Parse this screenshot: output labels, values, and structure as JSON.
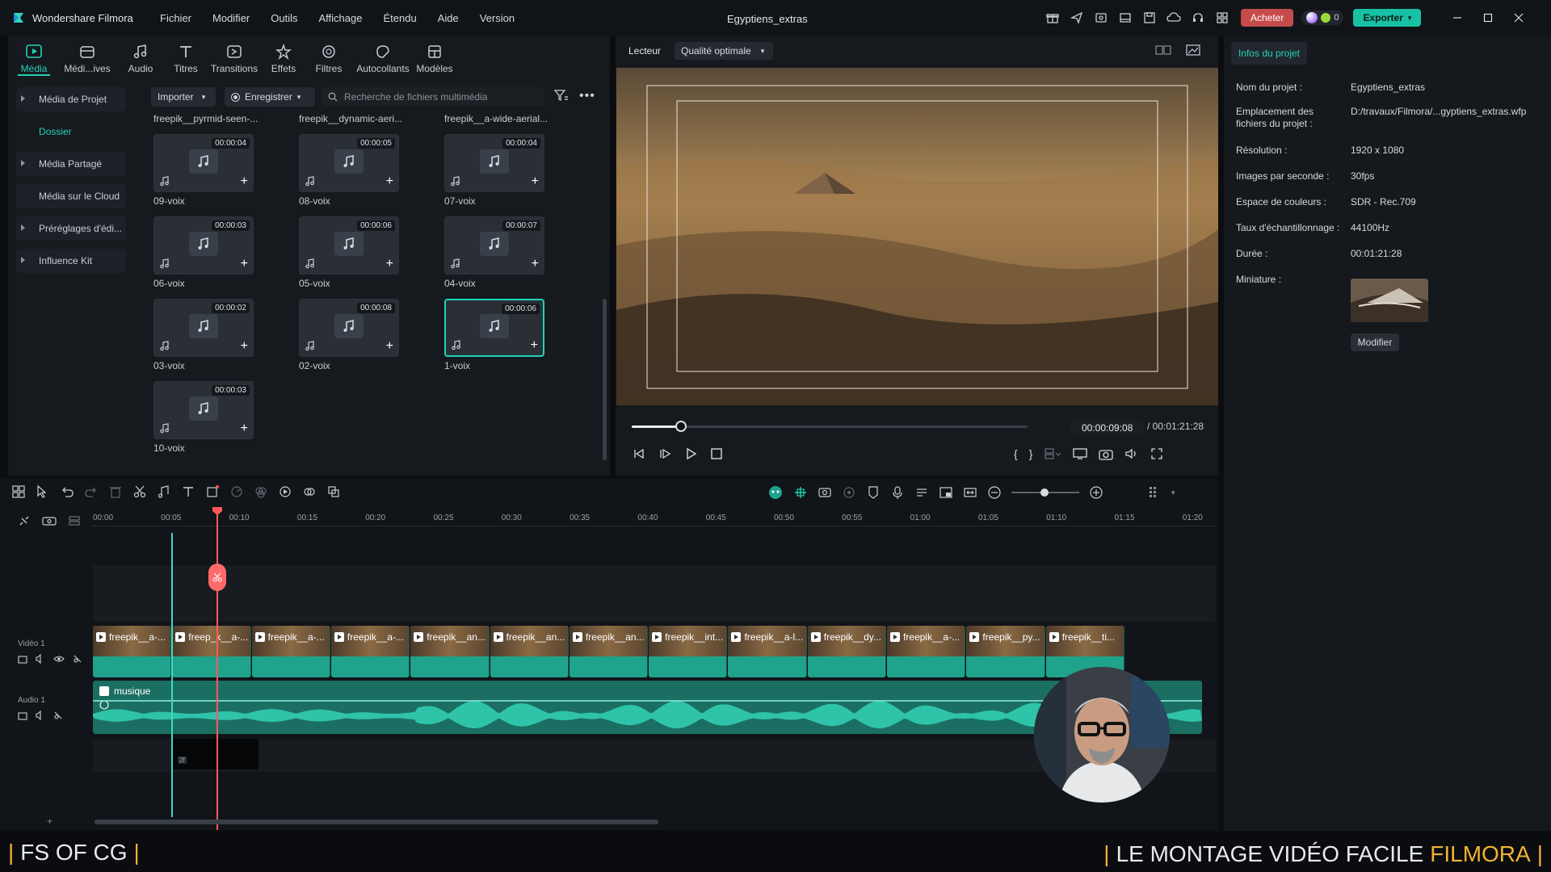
{
  "app": {
    "name": "Wondershare Filmora",
    "project_title": "Egyptiens_extras"
  },
  "menu": [
    "Fichier",
    "Modifier",
    "Outils",
    "Affichage",
    "Étendu",
    "Aide",
    "Version"
  ],
  "topbar": {
    "buy_label": "Acheter",
    "credits": "0",
    "export_label": "Exporter"
  },
  "tool_tabs": [
    {
      "label": "Média",
      "icon": "media-icon"
    },
    {
      "label": "Médi...ives",
      "icon": "stock-media-icon"
    },
    {
      "label": "Audio",
      "icon": "music-icon"
    },
    {
      "label": "Titres",
      "icon": "text-icon"
    },
    {
      "label": "Transitions",
      "icon": "transition-icon"
    },
    {
      "label": "Effets",
      "icon": "effects-icon"
    },
    {
      "label": "Filtres",
      "icon": "filter-icon"
    },
    {
      "label": "Autocollants",
      "icon": "sticker-icon"
    },
    {
      "label": "Modèles",
      "icon": "template-icon"
    }
  ],
  "sidebar": {
    "items": [
      {
        "label": "Média de Projet",
        "expandable": true
      },
      {
        "label": "Dossier",
        "expandable": false
      },
      {
        "label": "Média Partagé",
        "expandable": true
      },
      {
        "label": "Média sur le Cloud",
        "expandable": false
      },
      {
        "label": "Préréglages d'édi...",
        "expandable": true
      },
      {
        "label": "Influence Kit",
        "expandable": true
      }
    ]
  },
  "media_toolbar": {
    "import_label": "Importer",
    "record_label": "Enregistrer",
    "search_placeholder": "Recherche de fichiers multimédia"
  },
  "media_columns": [
    "freepik__pyrmid-seen-...",
    "freepik__dynamic-aeri...",
    "freepik__a-wide-aerial..."
  ],
  "media_items": [
    {
      "name": "09-voix",
      "duration": "00:00:04"
    },
    {
      "name": "08-voix",
      "duration": "00:00:05"
    },
    {
      "name": "07-voix",
      "duration": "00:00:04"
    },
    {
      "name": "06-voix",
      "duration": "00:00:03"
    },
    {
      "name": "05-voix",
      "duration": "00:00:06"
    },
    {
      "name": "04-voix",
      "duration": "00:00:07"
    },
    {
      "name": "03-voix",
      "duration": "00:00:02"
    },
    {
      "name": "02-voix",
      "duration": "00:00:08"
    },
    {
      "name": "1-voix",
      "duration": "00:00:06",
      "selected": true
    },
    {
      "name": "10-voix",
      "duration": "00:00:03"
    }
  ],
  "player": {
    "tab_label": "Lecteur",
    "quality_label": "Qualité optimale",
    "current_time": "00:00:09:08",
    "total_time": "/ 00:01:21:28",
    "progress_fraction": 0.125
  },
  "project_info": {
    "tab_label": "Infos du projet",
    "rows": [
      {
        "label": "Nom du projet :",
        "value": "Egyptiens_extras"
      },
      {
        "label": "Emplacement des fichiers du projet :",
        "value": "D:/travaux/Filmora/...gyptiens_extras.wfp"
      },
      {
        "label": "Résolution :",
        "value": "1920 x 1080"
      },
      {
        "label": "Images par seconde :",
        "value": "30fps"
      },
      {
        "label": "Espace de couleurs :",
        "value": "SDR - Rec.709"
      },
      {
        "label": "Taux d'échantillonnage :",
        "value": "44100Hz"
      },
      {
        "label": "Durée :",
        "value": "00:01:21:28"
      },
      {
        "label": "Miniature :",
        "value": ""
      }
    ],
    "modify_label": "Modifier"
  },
  "timeline": {
    "ruler": [
      "00:00",
      "00:05",
      "00:10",
      "00:15",
      "00:20",
      "00:25",
      "00:30",
      "00:35",
      "00:40",
      "00:45",
      "00:50",
      "00:55",
      "01:00",
      "01:05",
      "01:10",
      "01:15",
      "01:20"
    ],
    "video_track_label": "Vidéo 1",
    "audio_track_label": "Audio 1",
    "audio_clip_label": "musique",
    "video_clips": [
      "freepik__a-...",
      "freep_k__a-...",
      "freepik__a-...",
      "freepik__a-...",
      "freepik__an...",
      "freepik__an...",
      "freepik__an...",
      "freepik__int...",
      "freepik__a-l...",
      "freepik__dy...",
      "freepik__a-...",
      "freepik__py...",
      "freepik__ti..."
    ],
    "small_clip_badge": "2f"
  },
  "banner": {
    "left_text": "FS OF CG",
    "right_text": "LE MONTAGE VIDÉO FACILE",
    "right_highlight": "FILMORA"
  },
  "colors": {
    "accent": "#22d3b4",
    "playhead": "#ff5a5a",
    "buy": "#c64b4b",
    "export": "#16c2a3",
    "banner_highlight": "#f2b233"
  }
}
